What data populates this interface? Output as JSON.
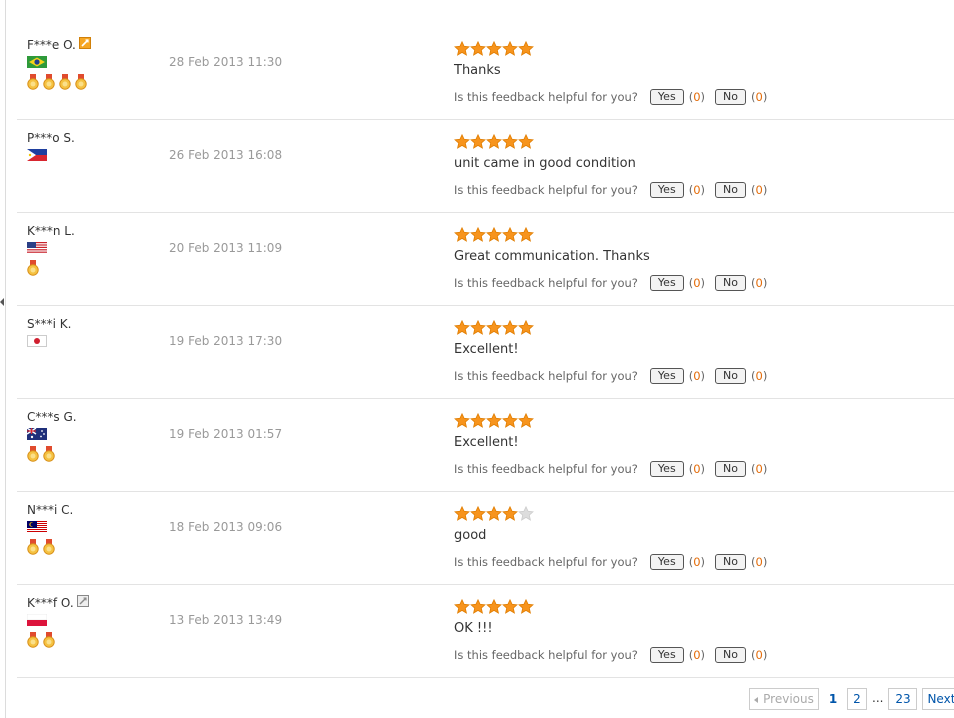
{
  "helpful": {
    "question": "Is this feedback helpful for you?",
    "yes_label": "Yes",
    "no_label": "No",
    "open_paren": "(",
    "close_paren": ")"
  },
  "colors": {
    "star_filled": "#f7941d",
    "star_empty": "#dddddd",
    "vote_count": "#e36c0a",
    "medal": "#f5c242",
    "link": "#0055aa"
  },
  "feedback": [
    {
      "buyer": "F***e O.",
      "level_icon": "gold-level-icon",
      "country_flag": "brazil-flag-icon",
      "medal_count": 4,
      "date": "28 Feb 2013 11:30",
      "rating": 5,
      "comment": "Thanks",
      "yes_count": "0",
      "no_count": "0"
    },
    {
      "buyer": "P***o S.",
      "level_icon": "",
      "country_flag": "philippines-flag-icon",
      "medal_count": 0,
      "date": "26 Feb 2013 16:08",
      "rating": 5,
      "comment": "unit came in good condition",
      "yes_count": "0",
      "no_count": "0"
    },
    {
      "buyer": "K***n L.",
      "level_icon": "",
      "country_flag": "usa-flag-icon",
      "medal_count": 1,
      "date": "20 Feb 2013 11:09",
      "rating": 5,
      "comment": "Great communication. Thanks",
      "yes_count": "0",
      "no_count": "0"
    },
    {
      "buyer": "S***i K.",
      "level_icon": "",
      "country_flag": "japan-flag-icon",
      "medal_count": 0,
      "date": "19 Feb 2013 17:30",
      "rating": 5,
      "comment": "Excellent!",
      "yes_count": "0",
      "no_count": "0"
    },
    {
      "buyer": "C***s G.",
      "level_icon": "",
      "country_flag": "australia-flag-icon",
      "medal_count": 2,
      "date": "19 Feb 2013 01:57",
      "rating": 5,
      "comment": "Excellent!",
      "yes_count": "0",
      "no_count": "0"
    },
    {
      "buyer": "N***i C.",
      "level_icon": "",
      "country_flag": "malaysia-flag-icon",
      "medal_count": 2,
      "date": "18 Feb 2013 09:06",
      "rating": 4,
      "comment": "good",
      "yes_count": "0",
      "no_count": "0"
    },
    {
      "buyer": "K***f O.",
      "level_icon": "gray-level-icon",
      "country_flag": "poland-flag-icon",
      "medal_count": 2,
      "date": "13 Feb 2013 13:49",
      "rating": 5,
      "comment": "OK !!!",
      "yes_count": "0",
      "no_count": "0"
    }
  ],
  "pagination": {
    "previous_label": "Previous",
    "current_page": "1",
    "page_2": "2",
    "ellipsis": "...",
    "last_page": "23",
    "next_label": "Next"
  }
}
